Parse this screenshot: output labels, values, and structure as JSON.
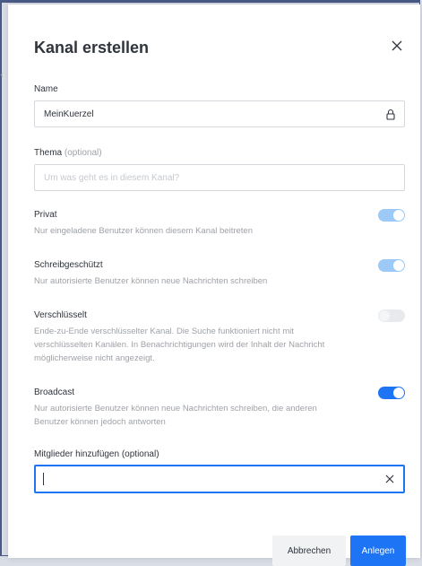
{
  "modal": {
    "title": "Kanal erstellen",
    "name_label": "Name",
    "name_value": "MeinKuerzel",
    "topic_label": "Thema",
    "topic_optional": "(optional)",
    "topic_placeholder": "Um was geht es in diesem Kanal?",
    "settings": [
      {
        "title": "Privat",
        "desc": "Nur eingeladene Benutzer können diesem Kanal beitreten",
        "state": "on-disabled"
      },
      {
        "title": "Schreibgeschützt",
        "desc": "Nur autorisierte Benutzer können neue Nachrichten schreiben",
        "state": "on-disabled"
      },
      {
        "title": "Verschlüsselt",
        "desc": "Ende-zu-Ende verschlüsselter Kanal. Die Suche funktioniert nicht mit verschlüsselten Kanälen. In Benachrichtigungen wird der Inhalt der Nachricht möglicherweise nicht angezeigt.",
        "state": "off-disabled"
      },
      {
        "title": "Broadcast",
        "desc": "Nur autorisierte Benutzer können neue Nachrichten schreiben, die anderen Benutzer können jedoch antworten",
        "state": "on"
      }
    ],
    "members_label": "Mitglieder hinzufügen (optional)",
    "members_value": "",
    "cancel_label": "Abbrechen",
    "create_label": "Anlegen"
  },
  "colors": {
    "primary": "#1d74f5",
    "toggle_disabled_on": "#9cc9f5",
    "text": "#2f343d",
    "muted": "#9ea2a8"
  },
  "icons": [
    "close-icon",
    "lock-icon",
    "clear-icon"
  ]
}
